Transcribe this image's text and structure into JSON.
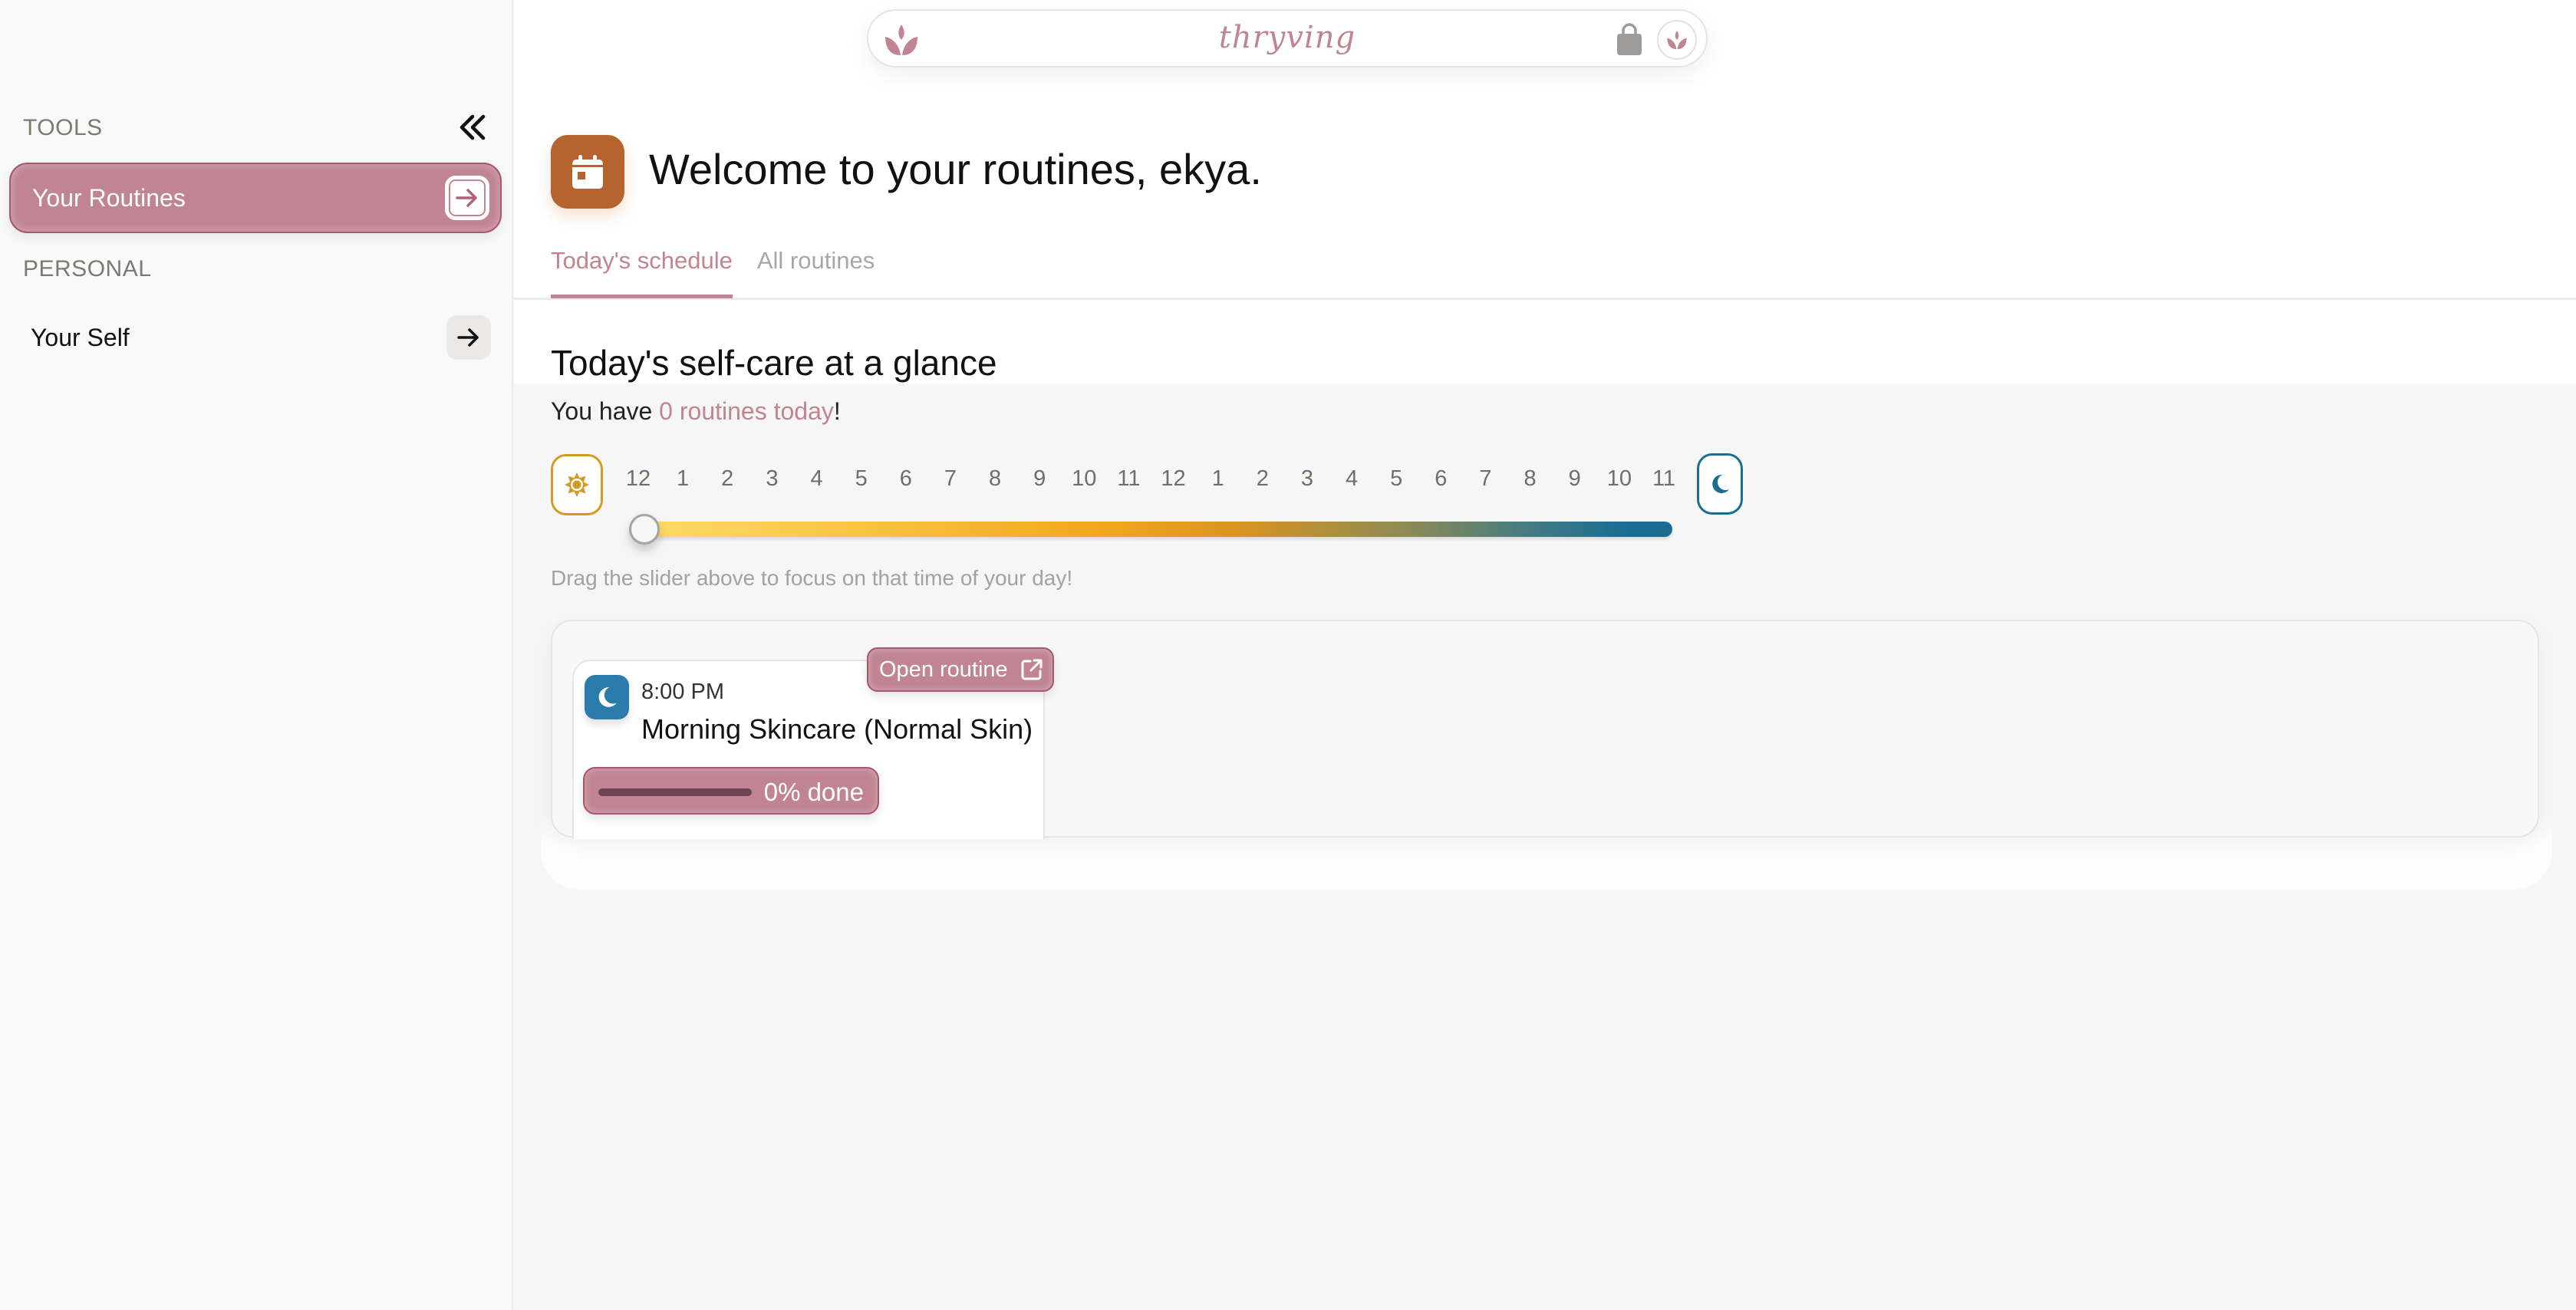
{
  "app": {
    "brand": "thryving"
  },
  "sidebar": {
    "sections": [
      {
        "heading": "TOOLS",
        "items": [
          {
            "label": "Your Routines",
            "active": true,
            "icon": "arrow-right-icon"
          }
        ]
      },
      {
        "heading": "PERSONAL",
        "items": [
          {
            "label": "Your Self",
            "active": false,
            "icon": "arrow-right-icon"
          }
        ]
      }
    ],
    "collapse_icon": "chevrons-left-icon"
  },
  "topbar": {
    "left_icon": "lotus-icon",
    "right_icons": [
      "shopping-bag-icon",
      "lotus-avatar-icon"
    ]
  },
  "header": {
    "icon": "calendar-icon",
    "title": "Welcome to your routines, ekya.",
    "tabs": [
      {
        "label": "Today's schedule",
        "active": true
      },
      {
        "label": "All routines",
        "active": false
      }
    ]
  },
  "glance": {
    "title": "Today's self-care at a glance",
    "subtitle_prefix": "You have ",
    "subtitle_highlight": "0 routines today",
    "subtitle_suffix": "!",
    "timeline": {
      "start_icon": "sun-icon",
      "end_icon": "moon-icon",
      "hours": [
        "12",
        "1",
        "2",
        "3",
        "4",
        "5",
        "6",
        "7",
        "8",
        "9",
        "10",
        "11",
        "12",
        "1",
        "2",
        "3",
        "4",
        "5",
        "6",
        "7",
        "8",
        "9",
        "10",
        "11"
      ],
      "slider_value_hour": 0,
      "gradient_colors": [
        "#fedc6a",
        "#f1a71e",
        "#1b6d93"
      ]
    },
    "hint": "Drag the slider above to focus on that time of your day!"
  },
  "routines": [
    {
      "icon": "moon-icon",
      "time": "8:00 PM",
      "name": "Morning Skincare (Normal Skin)",
      "open_label": "Open routine",
      "open_icon": "external-link-icon",
      "progress_fraction": 0,
      "progress_label": "0% done"
    }
  ],
  "colors": {
    "accent": "#c08493",
    "accent_border": "#a8586e",
    "calendar_icon_bg": "#b5632f",
    "sun": "#d59a25",
    "moon": "#1b6d93"
  }
}
